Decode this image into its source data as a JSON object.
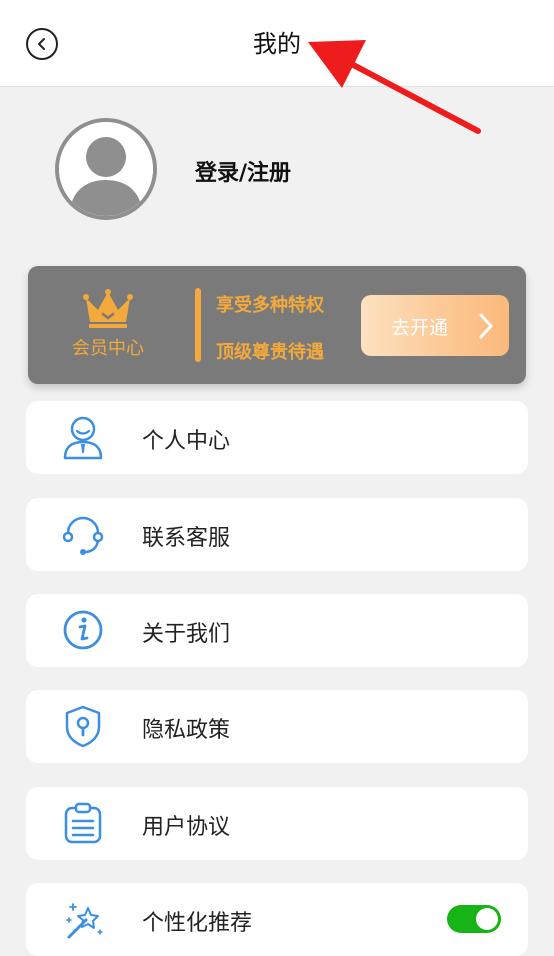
{
  "header": {
    "title": "我的"
  },
  "profile": {
    "login_label": "登录/注册"
  },
  "vip": {
    "label": "会员中心",
    "line1": "享受多种特权",
    "line2": "顶级尊贵待遇",
    "button_label": "去开通",
    "accent_color": "#f3a93c"
  },
  "menu": {
    "items": [
      {
        "label": "个人中心",
        "icon": "person-icon"
      },
      {
        "label": "联系客服",
        "icon": "headset-icon"
      },
      {
        "label": "关于我们",
        "icon": "info-icon"
      },
      {
        "label": "隐私政策",
        "icon": "shield-keyhole-icon"
      },
      {
        "label": "用户协议",
        "icon": "clipboard-icon"
      },
      {
        "label": "个性化推荐",
        "icon": "magic-wand-icon",
        "toggle_on": true
      }
    ]
  },
  "colors": {
    "icon_blue": "#3b8fe3",
    "toggle_green": "#17b417",
    "vip_card_bg": "#7a7a7a"
  }
}
